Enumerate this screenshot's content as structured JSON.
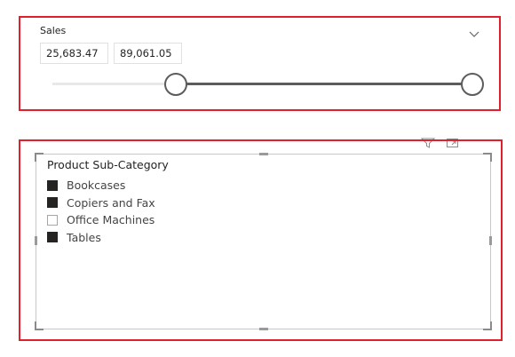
{
  "sales_slicer": {
    "title": "Sales",
    "min_value": "25,683.47",
    "max_value": "89,061.05",
    "colors": {
      "track_selected": "#5c5c5c",
      "track_rest": "#e8e8e8"
    },
    "icons": {
      "dropdown": "chevron-down-icon"
    }
  },
  "subcategory_slicer": {
    "header": "Product Sub-Category",
    "items": [
      {
        "label": "Bookcases",
        "checked": true
      },
      {
        "label": "Copiers and Fax",
        "checked": true
      },
      {
        "label": "Office Machines",
        "checked": false
      },
      {
        "label": "Tables",
        "checked": true
      }
    ],
    "toolbar_icons": [
      "filter-icon",
      "focus-mode-icon"
    ]
  },
  "accent_color": "#e0202a"
}
